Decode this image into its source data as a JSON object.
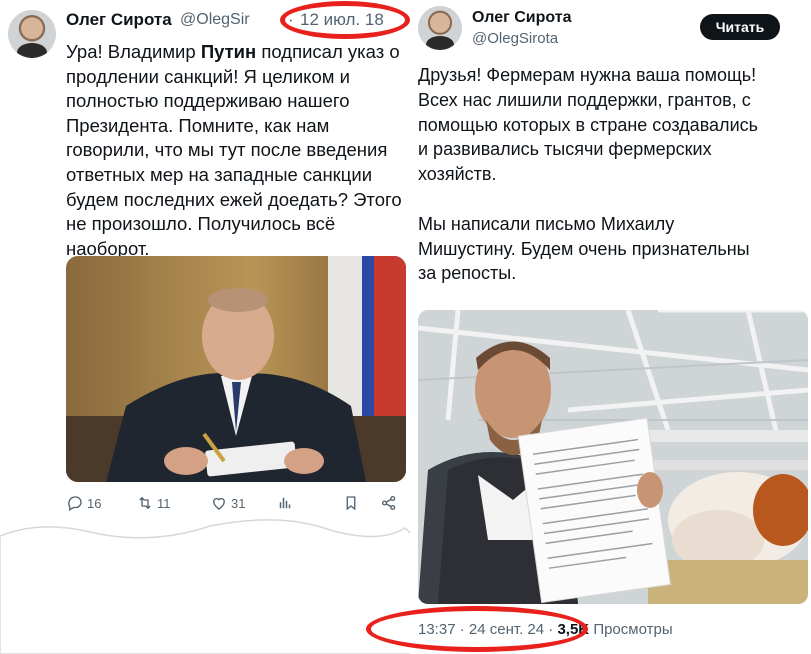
{
  "left_tweet": {
    "author_name": "Олег Сирота",
    "author_handle": "@OlegSir",
    "date_separator": "·",
    "date": "12 июл. 18",
    "text_lines": [
      {
        "pre": "Ура! Владимир ",
        "bold": "Путин",
        "post": " подписал указ о"
      },
      {
        "pre": "продлении санкций!  Я целиком и"
      },
      {
        "pre": "полностью поддерживаю нашего"
      },
      {
        "pre": "Президента. Помните, как нам"
      },
      {
        "pre": "говорили, что мы тут после введения"
      },
      {
        "pre": "ответных мер на западные санкции"
      },
      {
        "pre": "будем последних ежей доедать? Этого"
      },
      {
        "pre": "не произошло. Получилось всё"
      },
      {
        "pre": "наоборот."
      }
    ],
    "actions": {
      "replies": "16",
      "retweets": "11",
      "likes": "31"
    }
  },
  "right_tweet": {
    "author_name": "Олег Сирота",
    "author_handle": "@OlegSirota",
    "follow_label": "Читать",
    "text_lines": [
      "Друзья! Фермерам нужна ваша помощь!",
      "Всех нас лишили поддержки, грантов, с",
      "помощью которых в стране создавались",
      "и развивались тысячи фермерских",
      "хозяйств.",
      "",
      "Мы написали письмо Михаилу",
      "Мишустину. Будем очень признательны",
      "за репосты."
    ],
    "time": "13:37",
    "separator": "·",
    "date": "24 сент. 24",
    "views_count": "3,5K",
    "views_label": "Просмотры"
  },
  "colors": {
    "text": "#0f1419",
    "muted": "#536471",
    "highlight": "#e8211c",
    "button": "#0f1419"
  },
  "icons": [
    "reply-icon",
    "retweet-icon",
    "like-icon",
    "views-icon",
    "bookmark-icon",
    "share-icon"
  ]
}
